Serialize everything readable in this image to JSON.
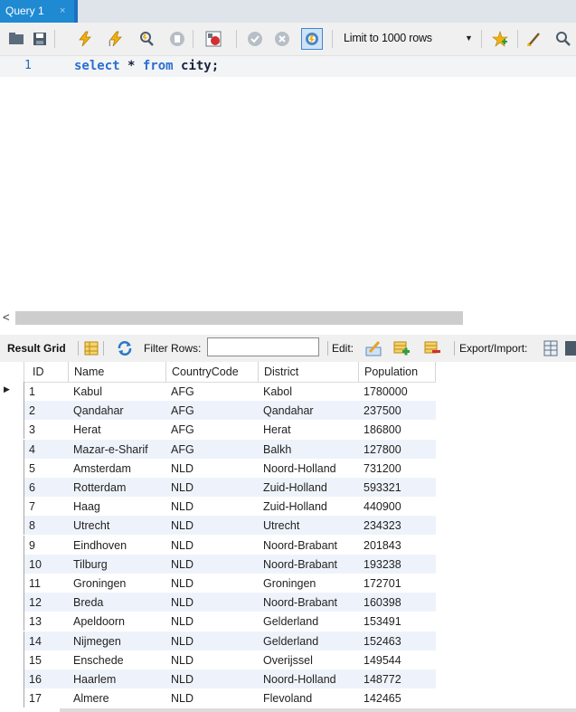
{
  "tab": {
    "title": "Query 1",
    "close_glyph": "×"
  },
  "toolbar": {
    "icons": [
      {
        "name": "open-folder-icon"
      },
      {
        "name": "save-icon"
      },
      {
        "name": "execute-icon"
      },
      {
        "name": "execute-current-icon"
      },
      {
        "name": "explain-icon"
      },
      {
        "name": "stop-icon"
      },
      {
        "name": "toggle-error-stop-icon"
      },
      {
        "name": "commit-icon"
      },
      {
        "name": "rollback-icon"
      },
      {
        "name": "autocommit-icon"
      },
      {
        "name": "add-snippet-icon"
      },
      {
        "name": "beautify-icon"
      },
      {
        "name": "find-icon"
      }
    ],
    "limit_label": "Limit to 1000 rows",
    "limit_arrow": "▼"
  },
  "editor": {
    "line_number": "1",
    "kw1": "select",
    "mid1": " * ",
    "kw2": "from",
    "rest": " city;"
  },
  "hscroll": {
    "left_arrow": "<"
  },
  "result_toolbar": {
    "result_grid_label": "Result Grid",
    "filter_label": "Filter Rows:",
    "filter_value": "",
    "edit_label": "Edit:",
    "export_label": "Export/Import:"
  },
  "grid": {
    "columns": [
      "ID",
      "Name",
      "CountryCode",
      "District",
      "Population"
    ],
    "selected_row_marker": "▶",
    "rows": [
      [
        "1",
        "Kabul",
        "AFG",
        "Kabol",
        "1780000"
      ],
      [
        "2",
        "Qandahar",
        "AFG",
        "Qandahar",
        "237500"
      ],
      [
        "3",
        "Herat",
        "AFG",
        "Herat",
        "186800"
      ],
      [
        "4",
        "Mazar-e-Sharif",
        "AFG",
        "Balkh",
        "127800"
      ],
      [
        "5",
        "Amsterdam",
        "NLD",
        "Noord-Holland",
        "731200"
      ],
      [
        "6",
        "Rotterdam",
        "NLD",
        "Zuid-Holland",
        "593321"
      ],
      [
        "7",
        "Haag",
        "NLD",
        "Zuid-Holland",
        "440900"
      ],
      [
        "8",
        "Utrecht",
        "NLD",
        "Utrecht",
        "234323"
      ],
      [
        "9",
        "Eindhoven",
        "NLD",
        "Noord-Brabant",
        "201843"
      ],
      [
        "10",
        "Tilburg",
        "NLD",
        "Noord-Brabant",
        "193238"
      ],
      [
        "11",
        "Groningen",
        "NLD",
        "Groningen",
        "172701"
      ],
      [
        "12",
        "Breda",
        "NLD",
        "Noord-Brabant",
        "160398"
      ],
      [
        "13",
        "Apeldoorn",
        "NLD",
        "Gelderland",
        "153491"
      ],
      [
        "14",
        "Nijmegen",
        "NLD",
        "Gelderland",
        "152463"
      ],
      [
        "15",
        "Enschede",
        "NLD",
        "Overijssel",
        "149544"
      ],
      [
        "16",
        "Haarlem",
        "NLD",
        "Noord-Holland",
        "148772"
      ],
      [
        "17",
        "Almere",
        "NLD",
        "Flevoland",
        "142465"
      ]
    ]
  }
}
